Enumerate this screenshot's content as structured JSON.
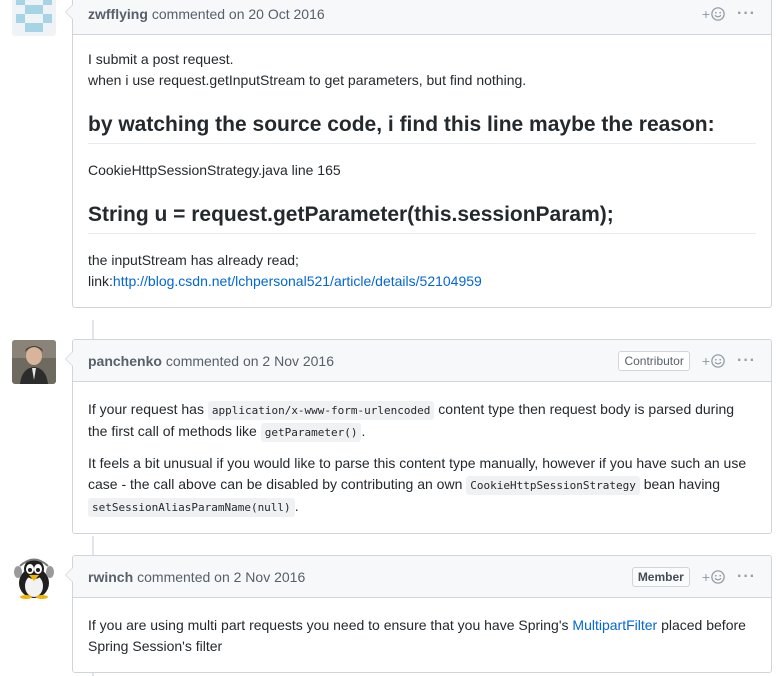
{
  "comments": [
    {
      "author": "zwfflying",
      "meta": "commented on 20 Oct 2016",
      "body": {
        "line1": "I submit a post request.",
        "line2": "when i use request.getInputStream to get parameters, but find nothing.",
        "heading1": "by watching the source code, i find this line maybe the reason:",
        "line3": "CookieHttpSessionStrategy.java line 165",
        "heading2": "String u = request.getParameter(this.sessionParam);",
        "line4": "the inputStream has already read;",
        "link_prefix": "link:",
        "link_text": "http://blog.csdn.net/lchpersonal521/article/details/52104959"
      }
    },
    {
      "author": "panchenko",
      "meta": "commented on 2 Nov 2016",
      "badge": "Contributor",
      "body": {
        "p1_a": "If your request has ",
        "p1_code1": "application/x-www-form-urlencoded",
        "p1_b": " content type then request body is parsed during the first call of methods like ",
        "p1_code2": "getParameter()",
        "p1_c": ".",
        "p2_a": "It feels a bit unusual if you would like to parse this content type manually, however if you have such an use case - the call above can be disabled by contributing an own ",
        "p2_code1": "CookieHttpSessionStrategy",
        "p2_b": " bean having ",
        "p2_code2": "setSessionAliasParamName(null)",
        "p2_c": "."
      }
    },
    {
      "author": "rwinch",
      "meta": "commented on 2 Nov 2016",
      "badge": "Member",
      "body": {
        "a": "If you are using multi part requests you need to ensure that you have Spring's ",
        "link_text": "MultipartFilter",
        "b": " placed before Spring Session's filter"
      }
    }
  ],
  "actions": {
    "react_plus": "+",
    "more": "···"
  },
  "colors": {
    "link": "#0366d6",
    "header_bg": "#f6f8fa",
    "border": "#d1d5da"
  },
  "icons": [
    "identicon-avatar",
    "photo-avatar",
    "penguin-avatar",
    "smiley-icon",
    "kebab-icon"
  ]
}
